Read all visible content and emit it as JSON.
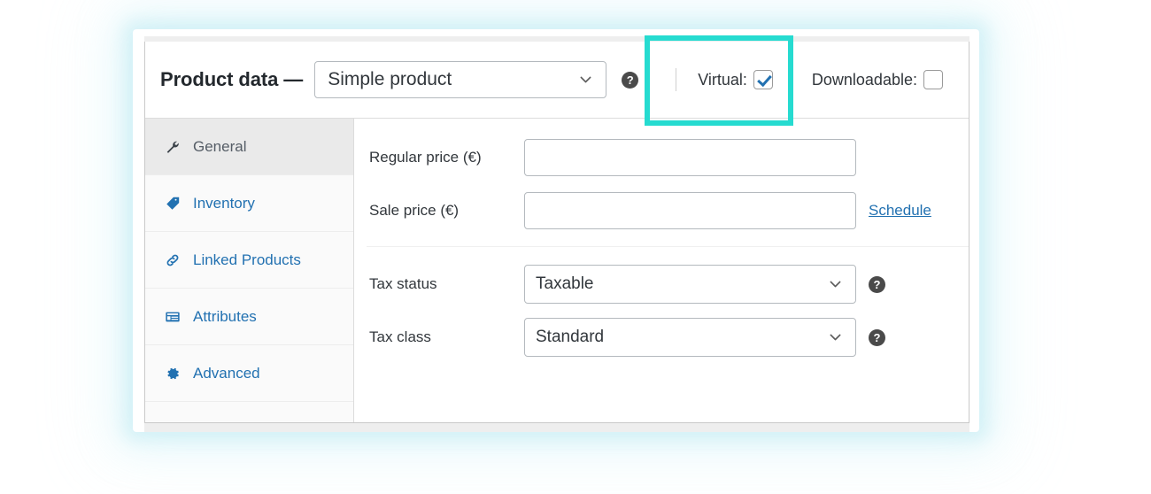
{
  "panel": {
    "title": "Product data —",
    "product_type": {
      "selected": "Simple product",
      "chevron_icon": "chevron-down-icon"
    },
    "header_help_icon": "help-icon",
    "checkboxes": [
      {
        "label": "Virtual:",
        "checked": true,
        "name": "virtual"
      },
      {
        "label": "Downloadable:",
        "checked": false,
        "name": "downloadable"
      }
    ]
  },
  "highlight": {
    "color": "#26dbd0",
    "target": "virtual-checkbox-group"
  },
  "tabs": [
    {
      "label": "General",
      "icon": "wrench-icon",
      "active": true
    },
    {
      "label": "Inventory",
      "icon": "tag-icon",
      "active": false
    },
    {
      "label": "Linked Products",
      "icon": "link-icon",
      "active": false
    },
    {
      "label": "Attributes",
      "icon": "list-card-icon",
      "active": false
    },
    {
      "label": "Advanced",
      "icon": "gear-icon",
      "active": false
    }
  ],
  "fields": {
    "regular_price": {
      "label": "Regular price (€)",
      "value": "",
      "placeholder": ""
    },
    "sale_price": {
      "label": "Sale price (€)",
      "value": "",
      "placeholder": "",
      "schedule_link": "Schedule"
    },
    "tax_status": {
      "label": "Tax status",
      "value": "Taxable",
      "help_icon": "help-icon",
      "chevron_icon": "chevron-down-icon"
    },
    "tax_class": {
      "label": "Tax class",
      "value": "Standard",
      "help_icon": "help-icon",
      "chevron_icon": "chevron-down-icon"
    }
  },
  "glyphs": {
    "help": "?"
  }
}
